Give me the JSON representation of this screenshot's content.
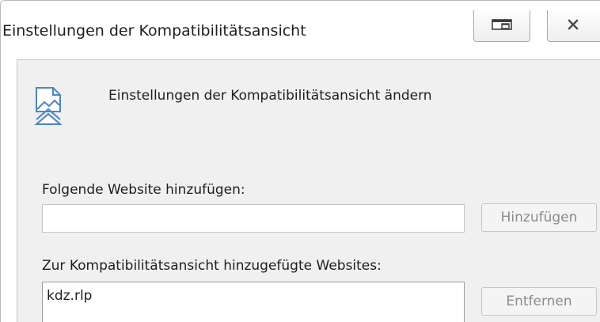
{
  "window": {
    "title": "Einstellungen der Kompatibilitätsansicht",
    "restore_icon": "restore-window-icon",
    "close_icon": "close-icon"
  },
  "header": {
    "icon": "compatibility-view-icon",
    "text": "Einstellungen der Kompatibilitätsansicht ändern"
  },
  "add_section": {
    "label": "Folgende Website hinzufügen:",
    "input_value": "",
    "input_placeholder": "",
    "button_label": "Hinzufügen"
  },
  "list_section": {
    "label": "Zur Kompatibilitätsansicht hinzugefügte Websites:",
    "sites": [
      "kdz.rlp"
    ],
    "button_label": "Entfernen"
  },
  "colors": {
    "dialog_background": "#f0f0f0",
    "disabled_text": "#8b8b8b",
    "icon_blue": "#4a86c5"
  }
}
